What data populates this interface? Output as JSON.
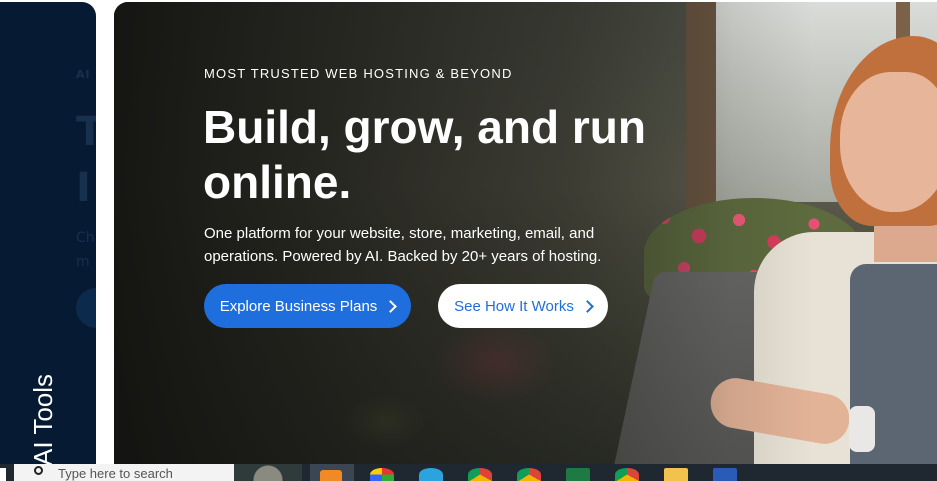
{
  "side_panel": {
    "eyebrow": "AI",
    "title_ghost": "T\nI",
    "text_ghost": "Ch\nm",
    "vertical_label": "AI Tools"
  },
  "hero": {
    "eyebrow": "MOST TRUSTED WEB HOSTING & BEYOND",
    "headline": "Build, grow, and run online.",
    "subtext": "One platform for your website, store, marketing, email, and operations. Powered by AI. Backed by 20+ years of hosting.",
    "primary_button": "Explore Business Plans",
    "secondary_button": "See How It Works"
  },
  "colors": {
    "primary_blue": "#1f6ede",
    "navy_panel": "#061a33",
    "white": "#ffffff",
    "taskbar": "#1f2730"
  },
  "taskbar": {
    "search_placeholder": "Type here to search",
    "icons": [
      "start-icon",
      "search-icon",
      "user-avatar-icon",
      "sun-app-icon",
      "picasa-icon",
      "telegram-icon",
      "chrome-icon",
      "chrome-icon",
      "excel-icon",
      "chrome-icon",
      "file-explorer-icon",
      "word-icon"
    ]
  }
}
